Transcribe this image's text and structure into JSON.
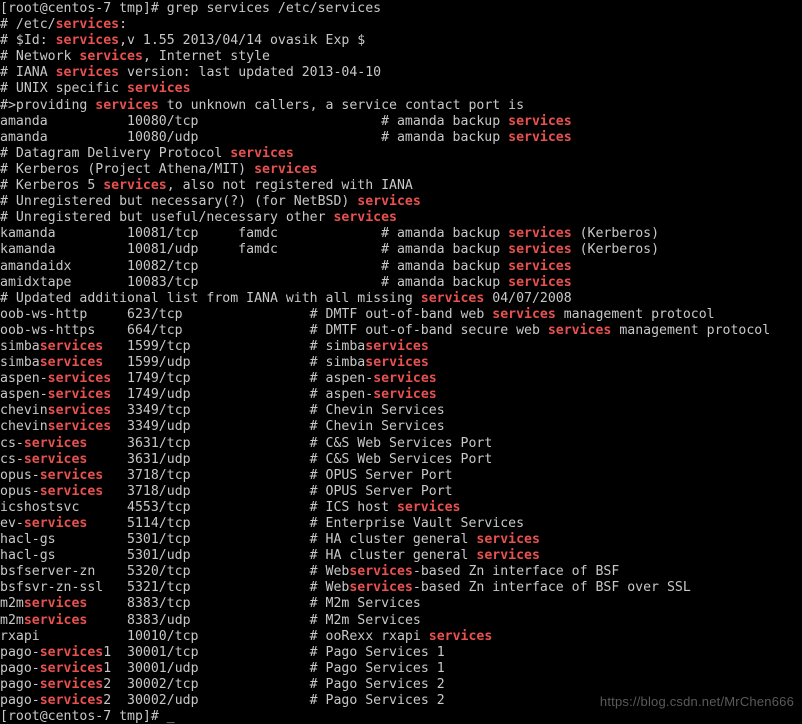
{
  "terminal": {
    "background_color": "#000000",
    "foreground_color": "#c8c8c8",
    "match_color": "#e8514f",
    "columns": 97,
    "rows": 45,
    "prompt": "[root@centos-7 tmp]#",
    "command": "grep services /etc/services",
    "cursor_glyph": "_"
  },
  "watermark": {
    "text": "https://blog.csdn.net/MrChen666",
    "color": "#5a5a5a"
  },
  "lines": [
    [
      {
        "t": "[root@centos-7 tmp]# grep ",
        "c": "default"
      },
      {
        "t": "services",
        "c": "default"
      },
      {
        "t": " /etc/",
        "c": "default"
      },
      {
        "t": "services",
        "c": "default"
      }
    ],
    [
      {
        "t": "# /etc/",
        "c": "default"
      },
      {
        "t": "services",
        "c": "match"
      },
      {
        "t": ":",
        "c": "default"
      }
    ],
    [
      {
        "t": "# $Id: ",
        "c": "default"
      },
      {
        "t": "services",
        "c": "match"
      },
      {
        "t": ",v 1.55 2013/04/14 ovasik Exp $",
        "c": "default"
      }
    ],
    [
      {
        "t": "# Network ",
        "c": "default"
      },
      {
        "t": "services",
        "c": "match"
      },
      {
        "t": ", Internet style",
        "c": "default"
      }
    ],
    [
      {
        "t": "# IANA ",
        "c": "default"
      },
      {
        "t": "services",
        "c": "match"
      },
      {
        "t": " version: last updated 2013-04-10",
        "c": "default"
      }
    ],
    [
      {
        "t": "# UNIX specific ",
        "c": "default"
      },
      {
        "t": "services",
        "c": "match"
      }
    ],
    [
      {
        "t": "#>providing ",
        "c": "default"
      },
      {
        "t": "services",
        "c": "match"
      },
      {
        "t": " to unknown callers, a service contact port is",
        "c": "default"
      }
    ],
    [
      {
        "t": "amanda          10080/tcp                       # amanda backup ",
        "c": "default"
      },
      {
        "t": "services",
        "c": "match"
      }
    ],
    [
      {
        "t": "amanda          10080/udp                       # amanda backup ",
        "c": "default"
      },
      {
        "t": "services",
        "c": "match"
      }
    ],
    [
      {
        "t": "# Datagram Delivery Protocol ",
        "c": "default"
      },
      {
        "t": "services",
        "c": "match"
      }
    ],
    [
      {
        "t": "# Kerberos (Project Athena/MIT) ",
        "c": "default"
      },
      {
        "t": "services",
        "c": "match"
      }
    ],
    [
      {
        "t": "# Kerberos 5 ",
        "c": "default"
      },
      {
        "t": "services",
        "c": "match"
      },
      {
        "t": ", also not registered with IANA",
        "c": "default"
      }
    ],
    [
      {
        "t": "# Unregistered but necessary(?) (for NetBSD) ",
        "c": "default"
      },
      {
        "t": "services",
        "c": "match"
      }
    ],
    [
      {
        "t": "# Unregistered but useful/necessary other ",
        "c": "default"
      },
      {
        "t": "services",
        "c": "match"
      }
    ],
    [
      {
        "t": "kamanda         10081/tcp     famdc             # amanda backup ",
        "c": "default"
      },
      {
        "t": "services",
        "c": "match"
      },
      {
        "t": " (Kerberos)",
        "c": "default"
      }
    ],
    [
      {
        "t": "kamanda         10081/udp     famdc             # amanda backup ",
        "c": "default"
      },
      {
        "t": "services",
        "c": "match"
      },
      {
        "t": " (Kerberos)",
        "c": "default"
      }
    ],
    [
      {
        "t": "amandaidx       10082/tcp                       # amanda backup ",
        "c": "default"
      },
      {
        "t": "services",
        "c": "match"
      }
    ],
    [
      {
        "t": "amidxtape       10083/tcp                       # amanda backup ",
        "c": "default"
      },
      {
        "t": "services",
        "c": "match"
      }
    ],
    [
      {
        "t": "# Updated additional list from IANA with all missing ",
        "c": "default"
      },
      {
        "t": "services",
        "c": "match"
      },
      {
        "t": " 04/07/2008",
        "c": "default"
      }
    ],
    [
      {
        "t": "oob-ws-http     623/tcp                # DMTF out-of-band web ",
        "c": "default"
      },
      {
        "t": "services",
        "c": "match"
      },
      {
        "t": " management protocol",
        "c": "default"
      }
    ],
    [
      {
        "t": "oob-ws-https    664/tcp                # DMTF out-of-band secure web ",
        "c": "default"
      },
      {
        "t": "services",
        "c": "match"
      },
      {
        "t": " management protocol",
        "c": "default"
      }
    ],
    [
      {
        "t": "simba",
        "c": "default"
      },
      {
        "t": "services",
        "c": "match"
      },
      {
        "t": "   1599/tcp               # simba",
        "c": "default"
      },
      {
        "t": "services",
        "c": "match"
      }
    ],
    [
      {
        "t": "simba",
        "c": "default"
      },
      {
        "t": "services",
        "c": "match"
      },
      {
        "t": "   1599/udp               # simba",
        "c": "default"
      },
      {
        "t": "services",
        "c": "match"
      }
    ],
    [
      {
        "t": "aspen-",
        "c": "default"
      },
      {
        "t": "services",
        "c": "match"
      },
      {
        "t": "  1749/tcp               # aspen-",
        "c": "default"
      },
      {
        "t": "services",
        "c": "match"
      }
    ],
    [
      {
        "t": "aspen-",
        "c": "default"
      },
      {
        "t": "services",
        "c": "match"
      },
      {
        "t": "  1749/udp               # aspen-",
        "c": "default"
      },
      {
        "t": "services",
        "c": "match"
      }
    ],
    [
      {
        "t": "chevin",
        "c": "default"
      },
      {
        "t": "services",
        "c": "match"
      },
      {
        "t": "  3349/tcp               # Chevin Services",
        "c": "default"
      }
    ],
    [
      {
        "t": "chevin",
        "c": "default"
      },
      {
        "t": "services",
        "c": "match"
      },
      {
        "t": "  3349/udp               # Chevin Services",
        "c": "default"
      }
    ],
    [
      {
        "t": "cs-",
        "c": "default"
      },
      {
        "t": "services",
        "c": "match"
      },
      {
        "t": "     3631/tcp               # C&S Web Services Port",
        "c": "default"
      }
    ],
    [
      {
        "t": "cs-",
        "c": "default"
      },
      {
        "t": "services",
        "c": "match"
      },
      {
        "t": "     3631/udp               # C&S Web Services Port",
        "c": "default"
      }
    ],
    [
      {
        "t": "opus-",
        "c": "default"
      },
      {
        "t": "services",
        "c": "match"
      },
      {
        "t": "   3718/tcp               # OPUS Server Port",
        "c": "default"
      }
    ],
    [
      {
        "t": "opus-",
        "c": "default"
      },
      {
        "t": "services",
        "c": "match"
      },
      {
        "t": "   3718/udp               # OPUS Server Port",
        "c": "default"
      }
    ],
    [
      {
        "t": "icshostsvc      4553/tcp               # ICS host ",
        "c": "default"
      },
      {
        "t": "services",
        "c": "match"
      }
    ],
    [
      {
        "t": "ev-",
        "c": "default"
      },
      {
        "t": "services",
        "c": "match"
      },
      {
        "t": "     5114/tcp               # Enterprise Vault Services",
        "c": "default"
      }
    ],
    [
      {
        "t": "hacl-gs         5301/tcp               # HA cluster general ",
        "c": "default"
      },
      {
        "t": "services",
        "c": "match"
      }
    ],
    [
      {
        "t": "hacl-gs         5301/udp               # HA cluster general ",
        "c": "default"
      },
      {
        "t": "services",
        "c": "match"
      }
    ],
    [
      {
        "t": "bsfserver-zn    5320/tcp               # Web",
        "c": "default"
      },
      {
        "t": "services",
        "c": "match"
      },
      {
        "t": "-based Zn interface of BSF",
        "c": "default"
      }
    ],
    [
      {
        "t": "bsfsvr-zn-ssl   5321/tcp               # Web",
        "c": "default"
      },
      {
        "t": "services",
        "c": "match"
      },
      {
        "t": "-based Zn interface of BSF over SSL",
        "c": "default"
      }
    ],
    [
      {
        "t": "m2m",
        "c": "default"
      },
      {
        "t": "services",
        "c": "match"
      },
      {
        "t": "     8383/tcp               # M2m Services",
        "c": "default"
      }
    ],
    [
      {
        "t": "m2m",
        "c": "default"
      },
      {
        "t": "services",
        "c": "match"
      },
      {
        "t": "     8383/udp               # M2m Services",
        "c": "default"
      }
    ],
    [
      {
        "t": "rxapi           10010/tcp              # ooRexx rxapi ",
        "c": "default"
      },
      {
        "t": "services",
        "c": "match"
      }
    ],
    [
      {
        "t": "pago-",
        "c": "default"
      },
      {
        "t": "services",
        "c": "match"
      },
      {
        "t": "1  30001/tcp              # Pago Services 1",
        "c": "default"
      }
    ],
    [
      {
        "t": "pago-",
        "c": "default"
      },
      {
        "t": "services",
        "c": "match"
      },
      {
        "t": "1  30001/udp              # Pago Services 1",
        "c": "default"
      }
    ],
    [
      {
        "t": "pago-",
        "c": "default"
      },
      {
        "t": "services",
        "c": "match"
      },
      {
        "t": "2  30002/tcp              # Pago Services 2",
        "c": "default"
      }
    ],
    [
      {
        "t": "pago-",
        "c": "default"
      },
      {
        "t": "services",
        "c": "match"
      },
      {
        "t": "2  30002/udp              # Pago Services 2",
        "c": "default"
      }
    ],
    [
      {
        "t": "[root@centos-7 tmp]# ",
        "c": "default"
      },
      {
        "t": "_",
        "c": "default"
      }
    ]
  ]
}
